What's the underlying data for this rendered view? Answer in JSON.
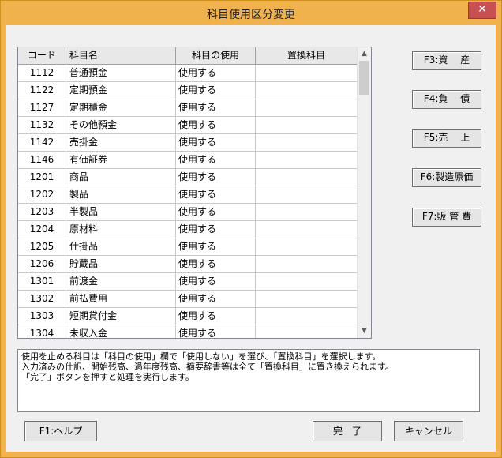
{
  "window": {
    "title": "科目使用区分変更",
    "close_label": "✕"
  },
  "grid": {
    "headers": [
      "コード",
      "科目名",
      "科目の使用",
      "置換科目"
    ],
    "rows": [
      {
        "code": "1112",
        "name": "普通預金",
        "usage": "使用する",
        "replace": ""
      },
      {
        "code": "1122",
        "name": "定期預金",
        "usage": "使用する",
        "replace": ""
      },
      {
        "code": "1127",
        "name": "定期積金",
        "usage": "使用する",
        "replace": ""
      },
      {
        "code": "1132",
        "name": "その他預金",
        "usage": "使用する",
        "replace": ""
      },
      {
        "code": "1142",
        "name": "売掛金",
        "usage": "使用する",
        "replace": ""
      },
      {
        "code": "1146",
        "name": "有価証券",
        "usage": "使用する",
        "replace": ""
      },
      {
        "code": "1201",
        "name": "商品",
        "usage": "使用する",
        "replace": ""
      },
      {
        "code": "1202",
        "name": "製品",
        "usage": "使用する",
        "replace": ""
      },
      {
        "code": "1203",
        "name": "半製品",
        "usage": "使用する",
        "replace": ""
      },
      {
        "code": "1204",
        "name": "原材料",
        "usage": "使用する",
        "replace": ""
      },
      {
        "code": "1205",
        "name": "仕掛品",
        "usage": "使用する",
        "replace": ""
      },
      {
        "code": "1206",
        "name": "貯蔵品",
        "usage": "使用する",
        "replace": ""
      },
      {
        "code": "1301",
        "name": "前渡金",
        "usage": "使用する",
        "replace": ""
      },
      {
        "code": "1302",
        "name": "前払費用",
        "usage": "使用する",
        "replace": ""
      },
      {
        "code": "1303",
        "name": "短期貸付金",
        "usage": "使用する",
        "replace": ""
      },
      {
        "code": "1304",
        "name": "未収入金",
        "usage": "使用する",
        "replace": ""
      }
    ]
  },
  "side_buttons": {
    "f3": "F3:資　 産",
    "f4": "F4:負　 債",
    "f5": "F5:売　 上",
    "f6": "F6:製造原価",
    "f7": "F7:販 管 費"
  },
  "message": {
    "line1": "使用を止める科目は「科目の使用」欄で「使用しない」を選び、「置換科目」を選択します。",
    "line2": "入力済みの仕訳、開始残高、過年度残高、摘要辞書等は全て「置換科目」に置き換えられます。",
    "line3": "「完了」ボタンを押すと処理を実行します。"
  },
  "bottom_buttons": {
    "help": "F1:ヘルプ",
    "done": "完　了",
    "cancel": "キャンセル"
  },
  "scrollbar": {
    "up_icon": "up-arrow-icon",
    "down_icon": "down-arrow-icon",
    "position": 0.0
  }
}
